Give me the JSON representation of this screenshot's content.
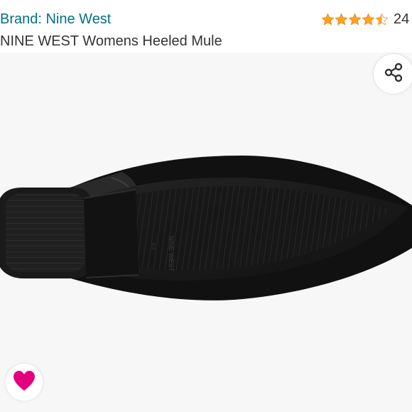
{
  "product": {
    "brand_label": "Brand: Nine West",
    "title": "NINE WEST Womens Heeled Mule",
    "rating": {
      "value": 4.5,
      "max": 5,
      "review_count": "24"
    }
  },
  "icons": {
    "share": "share-icon",
    "like": "heart-icon",
    "star": "star-icon"
  },
  "colors": {
    "brand_link": "#007185",
    "star_fill": "#FFA41C",
    "heart": "#E3007F",
    "image_background": "#F7F7F7"
  }
}
